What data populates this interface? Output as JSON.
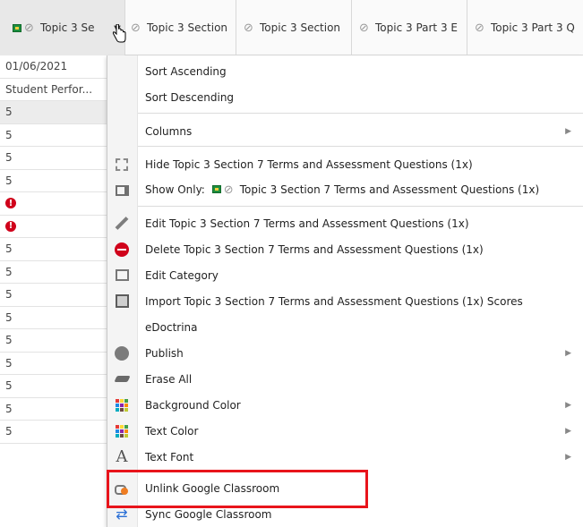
{
  "header": {
    "columns": [
      {
        "label": "Topic 3 Se"
      },
      {
        "label": "Topic 3 Section"
      },
      {
        "label": "Topic 3 Section"
      },
      {
        "label": "Topic 3 Part 3 E"
      },
      {
        "label": "Topic 3 Part 3 Q"
      }
    ]
  },
  "column": {
    "rows": [
      "01/06/2021",
      "Student Perfor...",
      "5",
      "5",
      "5",
      "5",
      "!",
      "!",
      "5",
      "5",
      "5",
      "5",
      "5",
      "5",
      "5",
      "5",
      "5"
    ]
  },
  "menu": {
    "sort_asc": "Sort Ascending",
    "sort_desc": "Sort Descending",
    "columns": "Columns",
    "hide": "Hide Topic 3 Section 7 Terms and Assessment Questions (1x)",
    "show_only_prefix": "Show Only:",
    "show_only_name": "Topic 3 Section 7 Terms and Assessment Questions (1x)",
    "edit": "Edit Topic 3 Section 7 Terms and Assessment Questions (1x)",
    "delete": "Delete Topic 3 Section 7 Terms and Assessment Questions (1x)",
    "edit_category": "Edit Category",
    "import": "Import Topic 3 Section 7 Terms and Assessment Questions (1x) Scores",
    "edoctrina": "eDoctrina",
    "publish": "Publish",
    "erase_all": "Erase All",
    "background_color": "Background Color",
    "text_color": "Text Color",
    "text_font": "Text Font",
    "unlink": "Unlink Google Classroom",
    "sync": "Sync Google Classroom"
  },
  "colors": {
    "highlight": "#e8141b",
    "alert": "#d0021b"
  }
}
